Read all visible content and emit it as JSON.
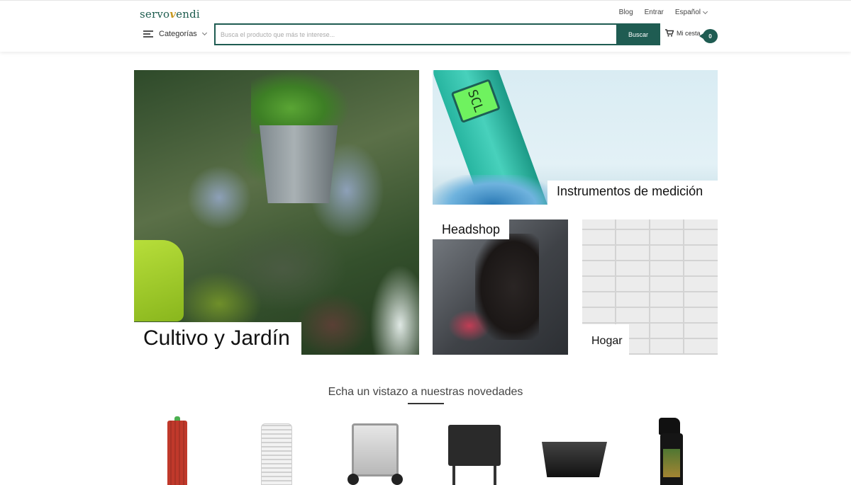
{
  "header": {
    "logo_prefix": "servo",
    "logo_v": "v",
    "logo_suffix": "endi",
    "top_links": {
      "blog": "Blog",
      "login": "Entrar",
      "language": "Español"
    },
    "categories_label": "Categorías",
    "search_placeholder": "Busca el producto que más te interese...",
    "search_button": "Buscar",
    "cart_label": "Mi cesta",
    "cart_count": "0"
  },
  "hero": {
    "garden": "Cultivo y Jardín",
    "measurement": "Instrumentos de medición",
    "headshop": "Headshop",
    "home": "Hogar",
    "meter_screen": "SCL"
  },
  "section": {
    "title": "Echa un vistazo a nuestras novedades"
  },
  "icons": [
    "hamburger-icon",
    "chevron-down-icon",
    "cart-icon"
  ],
  "colors": {
    "brand": "#1f5c52",
    "accent": "#c89a22"
  }
}
